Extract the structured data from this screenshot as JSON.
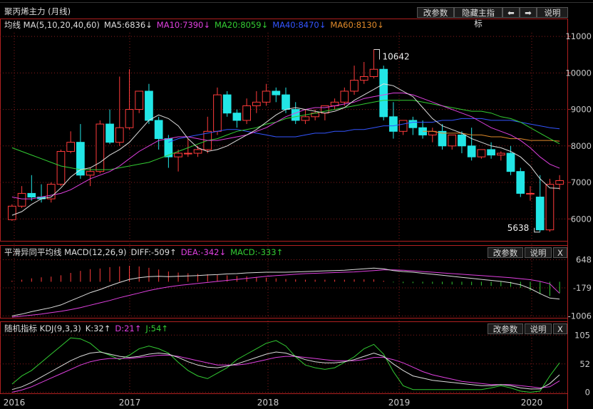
{
  "main_panel": {
    "title": "聚丙烯主力 (月线)",
    "buttons": {
      "params": "改参数",
      "hide_indicator": "隐藏主指标",
      "prev": "⬅",
      "next": "➡",
      "help": "说明"
    },
    "legend": [
      {
        "label": "均线 MA(5,10,20,40,60)",
        "color": "#dddddd"
      },
      {
        "label": "MA5:6836↓",
        "color": "#dddddd"
      },
      {
        "label": "MA10:7390↓",
        "color": "#e040e0"
      },
      {
        "label": "MA20:8059↓",
        "color": "#33cc33"
      },
      {
        "label": "MA40:8470↓",
        "color": "#3355ff"
      },
      {
        "label": "MA60:8130↓",
        "color": "#e08a2a"
      }
    ],
    "high_label": "10642",
    "low_label": "5638"
  },
  "macd_panel": {
    "legend": [
      {
        "label": "平滑异同平均线 MACD(12,26,9)",
        "color": "#dddddd"
      },
      {
        "label": "DIFF:-509↑",
        "color": "#dddddd"
      },
      {
        "label": "DEA:-342↓",
        "color": "#e040e0"
      },
      {
        "label": "MACD:-333↑",
        "color": "#33cc33"
      }
    ],
    "buttons": {
      "params": "改参数",
      "help": "说明",
      "close": "X"
    }
  },
  "kdj_panel": {
    "legend": [
      {
        "label": "随机指标 KDJ(9,3,3)",
        "color": "#dddddd"
      },
      {
        "label": "K:32↑",
        "color": "#dddddd"
      },
      {
        "label": "D:21↑",
        "color": "#e040e0"
      },
      {
        "label": "J:54↑",
        "color": "#33cc33"
      }
    ],
    "buttons": {
      "params": "改参数",
      "help": "说明",
      "close": "X"
    }
  },
  "colors": {
    "up": "#ff3b3b",
    "down": "#22e6e6",
    "grid": "#8a1c1c",
    "axis": "#b02020",
    "text": "#cccccc"
  },
  "chart_data": {
    "type": "candlestick",
    "price_axis": {
      "ticks": [
        6000,
        7000,
        8000,
        9000,
        10000,
        11000
      ]
    },
    "macd_axis": {
      "ticks": [
        648,
        -179,
        -1006
      ]
    },
    "kdj_axis": {
      "ticks": [
        105,
        52,
        0
      ]
    },
    "x_axis": {
      "labels": [
        "2016",
        "2017",
        "2018",
        "2019",
        "2020"
      ]
    },
    "candles": [
      [
        5980,
        6400,
        6350,
        5950
      ],
      [
        6350,
        6900,
        6700,
        6300
      ],
      [
        6700,
        7200,
        6600,
        6500
      ],
      [
        6600,
        6950,
        6550,
        6450
      ],
      [
        6550,
        7000,
        6950,
        6450
      ],
      [
        6950,
        7900,
        7850,
        6900
      ],
      [
        7850,
        8400,
        8100,
        7800
      ],
      [
        8100,
        8600,
        7200,
        7100
      ],
      [
        7200,
        7400,
        7300,
        6900
      ],
      [
        7300,
        8700,
        8600,
        7250
      ],
      [
        8600,
        9000,
        8100,
        8050
      ],
      [
        8100,
        9900,
        8500,
        8000
      ],
      [
        8500,
        10100,
        9000,
        8450
      ],
      [
        9000,
        9400,
        9500,
        8900
      ],
      [
        9500,
        9700,
        8700,
        8600
      ],
      [
        8700,
        8800,
        8200,
        7900
      ],
      [
        8200,
        8300,
        7700,
        7400
      ],
      [
        7700,
        7900,
        7800,
        7300
      ],
      [
        7800,
        8200,
        7800,
        7700
      ],
      [
        7800,
        8000,
        7900,
        7700
      ],
      [
        7900,
        8800,
        8400,
        7800
      ],
      [
        8400,
        9600,
        9400,
        8300
      ],
      [
        9400,
        9500,
        8900,
        8800
      ],
      [
        8900,
        9000,
        8700,
        8500
      ],
      [
        8700,
        9300,
        9100,
        8600
      ],
      [
        9100,
        9500,
        9200,
        8900
      ],
      [
        9200,
        9700,
        9500,
        9100
      ],
      [
        9500,
        9600,
        9400,
        9200
      ],
      [
        9400,
        9600,
        9000,
        8900
      ],
      [
        9000,
        9200,
        8700,
        8600
      ],
      [
        8700,
        9000,
        8800,
        8600
      ],
      [
        8800,
        9000,
        8900,
        8700
      ],
      [
        8900,
        9100,
        9100,
        8700
      ],
      [
        9100,
        9300,
        9200,
        9000
      ],
      [
        9200,
        9600,
        9500,
        9100
      ],
      [
        9500,
        10200,
        9800,
        9400
      ],
      [
        9800,
        10300,
        9900,
        9700
      ],
      [
        9900,
        10642,
        10100,
        9850
      ],
      [
        10100,
        10200,
        8800,
        8700
      ],
      [
        8800,
        9200,
        8400,
        8200
      ],
      [
        8400,
        8700,
        8700,
        8300
      ],
      [
        8700,
        8800,
        8500,
        8300
      ],
      [
        8500,
        8700,
        8300,
        8200
      ],
      [
        8300,
        8500,
        8400,
        8100
      ],
      [
        8400,
        8600,
        8000,
        7900
      ],
      [
        8000,
        8300,
        8300,
        7900
      ],
      [
        8300,
        8400,
        8000,
        7800
      ],
      [
        8000,
        8500,
        7700,
        7600
      ],
      [
        7700,
        7800,
        7900,
        7650
      ],
      [
        7900,
        8100,
        7750,
        7650
      ],
      [
        7750,
        7850,
        7800,
        7600
      ],
      [
        7800,
        8000,
        7300,
        7200
      ],
      [
        7300,
        7400,
        6700,
        6600
      ],
      [
        6700,
        6900,
        6700,
        6500
      ],
      [
        6600,
        7200,
        5700,
        5638
      ],
      [
        5700,
        7100,
        6950,
        5650
      ],
      [
        6950,
        7200,
        7050,
        6800
      ]
    ],
    "ma5": [
      6100,
      6200,
      6400,
      6550,
      6600,
      6850,
      7150,
      7350,
      7400,
      7550,
      7750,
      7900,
      8100,
      8400,
      8700,
      8850,
      8750,
      8550,
      8200,
      7950,
      7850,
      7900,
      8000,
      8150,
      8300,
      8450,
      8650,
      8850,
      9000,
      9050,
      9000,
      8950,
      8900,
      8950,
      9050,
      9250,
      9400,
      9550,
      9700,
      9650,
      9500,
      9350,
      9050,
      8750,
      8550,
      8450,
      8350,
      8200,
      8100,
      8000,
      7950,
      7850,
      7700,
      7450,
      7100,
      6850,
      6836
    ],
    "ma10": [
      6600,
      6550,
      6550,
      6600,
      6650,
      6700,
      6800,
      6950,
      7100,
      7200,
      7300,
      7450,
      7650,
      7850,
      8000,
      8150,
      8200,
      8250,
      8250,
      8200,
      8150,
      8150,
      8200,
      8250,
      8300,
      8400,
      8500,
      8650,
      8800,
      8900,
      9000,
      9050,
      9050,
      9100,
      9150,
      9200,
      9300,
      9350,
      9400,
      9450,
      9450,
      9400,
      9300,
      9200,
      9100,
      9000,
      8900,
      8800,
      8650,
      8500,
      8400,
      8300,
      8150,
      7950,
      7700,
      7500,
      7390
    ],
    "ma20": [
      7950,
      7850,
      7750,
      7650,
      7550,
      7450,
      7400,
      7350,
      7350,
      7350,
      7350,
      7400,
      7450,
      7500,
      7550,
      7650,
      7750,
      7850,
      7950,
      8050,
      8150,
      8200,
      8300,
      8400,
      8450,
      8500,
      8600,
      8650,
      8750,
      8800,
      8850,
      8900,
      8950,
      9000,
      9050,
      9100,
      9150,
      9200,
      9250,
      9250,
      9250,
      9250,
      9200,
      9150,
      9100,
      9050,
      9000,
      8950,
      8950,
      8900,
      8800,
      8750,
      8650,
      8500,
      8350,
      8200,
      8059
    ],
    "ma40": [
      null,
      null,
      null,
      null,
      null,
      null,
      null,
      null,
      null,
      null,
      null,
      null,
      null,
      null,
      null,
      null,
      8100,
      8200,
      8250,
      8300,
      8350,
      8400,
      8450,
      8450,
      8400,
      8350,
      8300,
      8250,
      8250,
      8250,
      8300,
      8350,
      8350,
      8400,
      8400,
      8450,
      8450,
      8500,
      8550,
      8550,
      8600,
      8650,
      8650,
      8650,
      8700,
      8700,
      8750,
      8750,
      8750,
      8700,
      8700,
      8700,
      8650,
      8600,
      8550,
      8500,
      8470
    ],
    "ma60": [
      null,
      null,
      null,
      null,
      null,
      null,
      null,
      null,
      null,
      null,
      null,
      null,
      null,
      null,
      null,
      null,
      null,
      null,
      null,
      null,
      null,
      null,
      null,
      null,
      null,
      null,
      null,
      null,
      null,
      null,
      null,
      null,
      null,
      null,
      null,
      null,
      null,
      null,
      null,
      null,
      null,
      null,
      8400,
      8400,
      8350,
      8350,
      8350,
      8300,
      8300,
      8250,
      8250,
      8200,
      8200,
      8150,
      8150,
      8150,
      8130
    ],
    "macd_diff": [
      -1006,
      -950,
      -880,
      -820,
      -760,
      -680,
      -560,
      -440,
      -320,
      -230,
      -120,
      -20,
      70,
      120,
      150,
      160,
      150,
      160,
      170,
      180,
      200,
      210,
      230,
      240,
      260,
      270,
      280,
      280,
      280,
      290,
      300,
      310,
      320,
      330,
      340,
      360,
      380,
      400,
      380,
      330,
      300,
      280,
      250,
      220,
      190,
      160,
      130,
      100,
      70,
      40,
      10,
      -30,
      -90,
      -200,
      -350,
      -480,
      -509
    ],
    "macd_dea": [
      -1040,
      -1010,
      -980,
      -950,
      -910,
      -870,
      -820,
      -760,
      -690,
      -620,
      -550,
      -470,
      -400,
      -330,
      -260,
      -200,
      -150,
      -110,
      -80,
      -50,
      -20,
      10,
      40,
      70,
      100,
      130,
      160,
      180,
      200,
      220,
      240,
      250,
      260,
      270,
      280,
      290,
      310,
      330,
      350,
      350,
      340,
      320,
      300,
      280,
      260,
      240,
      220,
      200,
      180,
      160,
      140,
      120,
      90,
      60,
      10,
      -60,
      -342
    ],
    "macd_hist": [
      30,
      60,
      100,
      130,
      150,
      190,
      260,
      320,
      370,
      390,
      430,
      450,
      470,
      450,
      410,
      360,
      300,
      270,
      250,
      230,
      220,
      200,
      190,
      170,
      160,
      140,
      120,
      100,
      80,
      70,
      60,
      60,
      60,
      60,
      60,
      70,
      70,
      70,
      30,
      -20,
      -40,
      -40,
      -50,
      -60,
      -70,
      -80,
      -90,
      -100,
      -110,
      -120,
      -130,
      -150,
      -180,
      -260,
      -360,
      -420,
      -333
    ],
    "kdj_k": [
      5,
      10,
      18,
      28,
      38,
      48,
      58,
      66,
      72,
      74,
      70,
      66,
      64,
      66,
      70,
      72,
      70,
      64,
      56,
      50,
      46,
      45,
      48,
      52,
      58,
      64,
      70,
      74,
      72,
      66,
      60,
      56,
      54,
      54,
      56,
      60,
      66,
      72,
      66,
      52,
      40,
      30,
      26,
      22,
      20,
      18,
      16,
      14,
      12,
      12,
      14,
      12,
      8,
      6,
      6,
      16,
      32
    ],
    "kdj_d": [
      0,
      4,
      10,
      18,
      26,
      34,
      42,
      50,
      56,
      60,
      62,
      62,
      62,
      64,
      66,
      68,
      68,
      66,
      62,
      58,
      54,
      50,
      50,
      50,
      52,
      56,
      60,
      64,
      66,
      66,
      64,
      62,
      60,
      58,
      58,
      58,
      60,
      64,
      64,
      60,
      54,
      46,
      38,
      32,
      28,
      24,
      20,
      18,
      16,
      14,
      14,
      14,
      12,
      10,
      8,
      10,
      21
    ],
    "kdj_j": [
      15,
      30,
      40,
      55,
      70,
      85,
      100,
      98,
      90,
      75,
      68,
      60,
      68,
      80,
      85,
      80,
      72,
      55,
      40,
      30,
      25,
      35,
      45,
      60,
      70,
      80,
      90,
      95,
      85,
      65,
      50,
      45,
      42,
      45,
      55,
      65,
      80,
      88,
      70,
      38,
      12,
      5,
      5,
      5,
      5,
      5,
      5,
      5,
      5,
      8,
      12,
      8,
      2,
      0,
      2,
      30,
      54
    ]
  }
}
